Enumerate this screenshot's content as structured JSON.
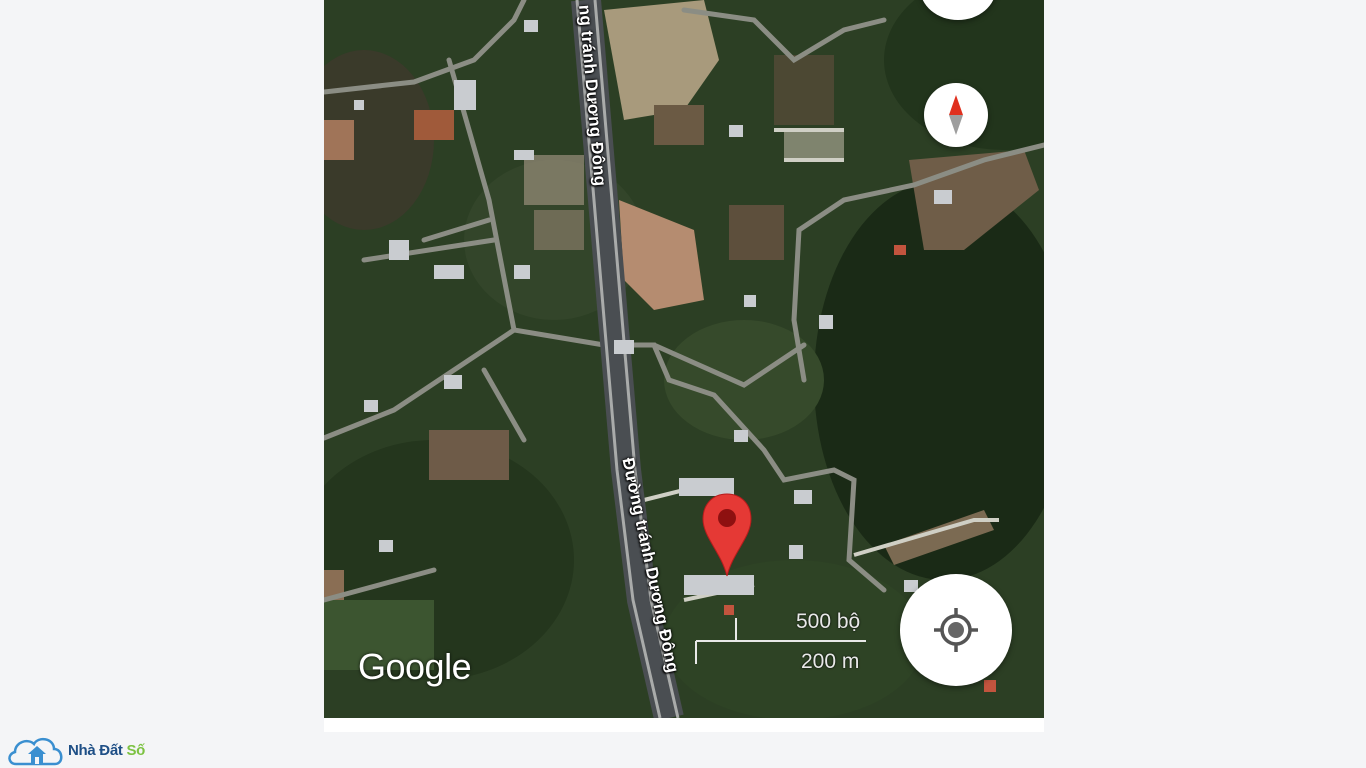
{
  "map": {
    "road_label_top": "ng tránh Dương Đông",
    "road_label_bottom": "Đường tránh Dương Đông",
    "logo_text": "Google",
    "scale_imperial": "500 bộ",
    "scale_metric": "200 m"
  },
  "controls": {
    "compass_icon": "compass-icon",
    "locate_icon": "my-location-icon",
    "pin_color": "#e53935"
  },
  "watermark": {
    "brand_part1": "Nhà Đất ",
    "brand_part2": "Số",
    "logo_icon": "cloud-house-icon"
  }
}
